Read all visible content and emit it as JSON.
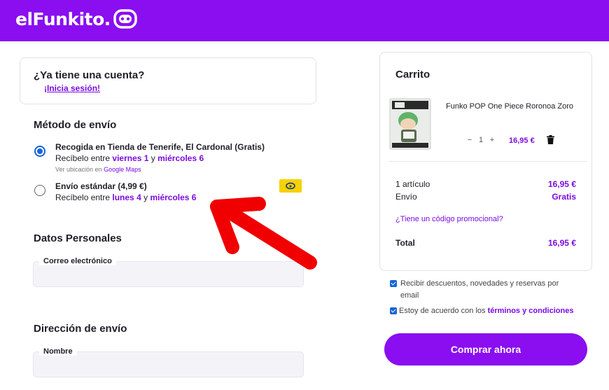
{
  "brand": {
    "name": "elFunkito.",
    "accent": "#8a0ef0",
    "link_color": "#7a0ae0"
  },
  "account": {
    "question": "¿Ya tiene una cuenta?",
    "login_link": "¡Inicia sesión!"
  },
  "shipping": {
    "title": "Método de envío",
    "options": [
      {
        "title": "Recogida en Tienda de Tenerife, El Cardonal (Gratis)",
        "receive_prefix": "Recíbelo entre",
        "day_from": "viernes 1",
        "conj": "y",
        "day_to": "miércoles 6",
        "map_prefix": "Ver ubicación en",
        "map_link": "Google Maps",
        "selected": true
      },
      {
        "title": "Envío estándar (4,99 €)",
        "receive_prefix": "Recíbelo entre",
        "day_from": "lunes 4",
        "conj": "y",
        "day_to": "miércoles 6",
        "badge_icon": "correos-logo-icon",
        "selected": false
      }
    ]
  },
  "personal": {
    "title": "Datos Personales",
    "email_label": "Correo electrónico"
  },
  "address": {
    "title": "Dirección de envío",
    "name_label": "Nombre"
  },
  "cart": {
    "title": "Carrito",
    "item": {
      "name": "Funko POP One Piece Roronoa Zoro",
      "qty": "1",
      "minus": "−",
      "plus": "+",
      "price": "16,95 €"
    },
    "articles_label": "1 artículo",
    "articles_value": "16,95 €",
    "shipping_label": "Envío",
    "shipping_value": "Gratis",
    "promo_link": "¿Tiene un código promocional?",
    "total_label": "Total",
    "total_value": "16,95 €"
  },
  "consents": {
    "newsletter": "Recibir descuentos, novedades y reservas por email",
    "terms_prefix": "Estoy de acuerdo con los",
    "terms_link": "términos y condiciones",
    "newsletter_checked": true,
    "terms_checked": true
  },
  "buy_button": "Comprar ahora"
}
